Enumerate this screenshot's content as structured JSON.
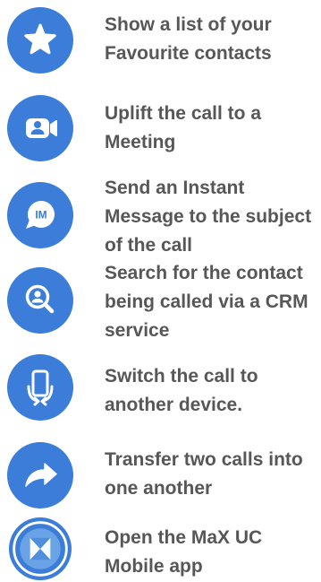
{
  "colors": {
    "icon_bg": "#3b7dd8",
    "text": "#575757",
    "icon_fg": "#ffffff"
  },
  "items": [
    {
      "icon": "star-icon",
      "lines": [
        "Show a list of your",
        "Favourite contacts"
      ]
    },
    {
      "icon": "meeting-video-icon",
      "lines": [
        "Uplift the call to a",
        "Meeting"
      ]
    },
    {
      "icon": "instant-message-icon",
      "icon_text": "IM",
      "lines": [
        "Send an Instant",
        "Message to the subject",
        "of the call"
      ]
    },
    {
      "icon": "contact-search-icon",
      "lines": [
        "Search for the contact",
        "being called via a CRM",
        "service"
      ]
    },
    {
      "icon": "switch-device-icon",
      "lines": [
        "Switch the call to",
        "another device."
      ]
    },
    {
      "icon": "transfer-arrow-icon",
      "lines": [
        "Transfer two calls into",
        "one another"
      ]
    },
    {
      "icon": "max-uc-logo-icon",
      "lines": [
        "Open the MaX UC",
        "Mobile app"
      ]
    }
  ]
}
